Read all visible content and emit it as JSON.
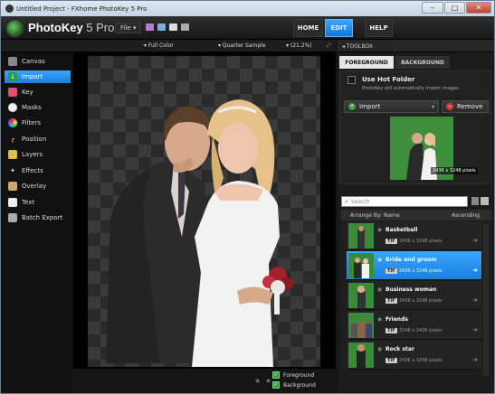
{
  "window": {
    "title": "Untitled Project - FXhome PhotoKey 5 Pro"
  },
  "app": {
    "name": "PhotoKey",
    "version": " 5 Pro",
    "file_menu": "File ▾"
  },
  "nav": {
    "home": "HOME",
    "edit": "EDIT",
    "help": "HELP"
  },
  "toolstrip": {
    "color_mode": "Full Color",
    "sample": "Quarter Sample",
    "zoom": "(21.2%)"
  },
  "sidebar": {
    "items": [
      {
        "label": "Canvas",
        "icon": "canvas-icon"
      },
      {
        "label": "Import",
        "icon": "import-icon"
      },
      {
        "label": "Key",
        "icon": "key-icon"
      },
      {
        "label": "Masks",
        "icon": "masks-icon"
      },
      {
        "label": "Filters",
        "icon": "filters-icon"
      },
      {
        "label": "Position",
        "icon": "position-icon"
      },
      {
        "label": "Layers",
        "icon": "layers-icon"
      },
      {
        "label": "Effects",
        "icon": "effects-icon"
      },
      {
        "label": "Overlay",
        "icon": "overlay-icon"
      },
      {
        "label": "Text",
        "icon": "text-icon"
      },
      {
        "label": "Batch Export",
        "icon": "batch-export-icon"
      }
    ],
    "active": "Import"
  },
  "layers": {
    "foreground": "Foreground",
    "background": "Background"
  },
  "toolbox": {
    "title": "TOOLBOX",
    "tab_foreground": "FOREGROUND",
    "tab_background": "BACKGROUND",
    "hot_folder_title": "Use Hot Folder",
    "hot_folder_desc": "PhotoKey will automatically import images",
    "import_label": "Import",
    "remove_label": "Remove",
    "preview_dims": "2436 x 3248 pixels",
    "search_placeholder": "Search",
    "arrange_label": "Arrange By: Name",
    "sort_label": "Ascending",
    "items": [
      {
        "name": "Basketball",
        "format": "TIF",
        "dims": "2436 x 3248 pixels"
      },
      {
        "name": "Bride and groom",
        "format": "TIF",
        "dims": "2436 x 3248 pixels"
      },
      {
        "name": "Business woman",
        "format": "TIF",
        "dims": "2436 x 3248 pixels"
      },
      {
        "name": "Friends",
        "format": "TIF",
        "dims": "3248 x 2436 pixels"
      },
      {
        "name": "Rock star",
        "format": "TIF",
        "dims": "2436 x 3248 pixels"
      }
    ],
    "selected": "Bride and groom"
  },
  "colors": {
    "accent": "#1b86ee",
    "green": "#3aa03a",
    "red": "#d23a2a"
  }
}
